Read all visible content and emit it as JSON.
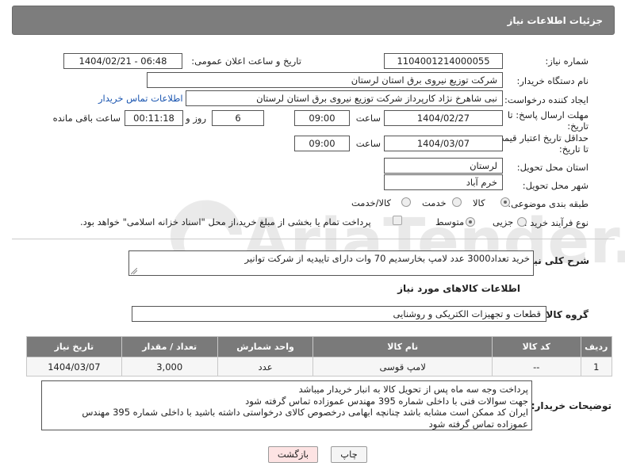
{
  "header": {
    "title": "جزئیات اطلاعات نیاز"
  },
  "form": {
    "need_number": {
      "label": "شماره نیاز:",
      "value": "1104001214000055"
    },
    "announce_datetime": {
      "label": "تاریخ و ساعت اعلان عمومی:",
      "value": "1404/02/21 - 06:48"
    },
    "buyer_org": {
      "label": "نام دستگاه خریدار:",
      "value": "شرکت توزیع نیروی برق استان لرستان"
    },
    "requester": {
      "label": "ایجاد کننده درخواست:",
      "value": "نبی شاهرخ نژاد کارپرداز شرکت توزیع نیروی برق استان لرستان",
      "contact_link": "اطلاعات تماس خریدار"
    },
    "reply_deadline": {
      "label_line1": "مهلت ارسال پاسخ: تا",
      "label_line2": "تاریخ:",
      "date": "1404/02/27",
      "time_label": "ساعت",
      "time": "09:00",
      "days": "6",
      "days_label": "روز و",
      "remaining": "00:11:18",
      "remaining_label": "ساعت باقی مانده"
    },
    "price_validity": {
      "label_line1": "حداقل تاریخ اعتبار قیمت:",
      "label_line2": "تا تاریخ:",
      "date": "1404/03/07",
      "time_label": "ساعت",
      "time": "09:00"
    },
    "delivery_province": {
      "label": "استان محل تحویل:",
      "value": "لرستان"
    },
    "delivery_city": {
      "label": "شهر محل تحویل:",
      "value": "خرم آباد"
    },
    "category": {
      "label": "طبقه بندی موضوعی:",
      "options": [
        "کالا",
        "خدمت",
        "کالا/خدمت"
      ],
      "selected": "کالا"
    },
    "purchase_type": {
      "label": "نوع فرآیند خرید :",
      "options": [
        "جزیی",
        "متوسط"
      ],
      "selected": "متوسط",
      "note": "پرداخت تمام یا بخشی از مبلغ خرید،از محل \"اسناد خزانه اسلامی\" خواهد بود."
    }
  },
  "description": {
    "label": "شرح کلی نیاز:",
    "value": "خرید تعداد3000 عدد لامپ بخارسدیم 70 وات دارای تاییدیه از شرکت توانیر"
  },
  "goods_section": {
    "title": "اطلاعات کالاهای مورد نیاز",
    "group_label": "گروه کالا:",
    "group_value": "قطعات و تجهیزات الکتریکی و روشنایی",
    "columns": [
      "ردیف",
      "کد کالا",
      "نام کالا",
      "واحد شمارش",
      "تعداد / مقدار",
      "تاریخ نیاز"
    ],
    "rows": [
      {
        "row": "1",
        "code": "--",
        "name": "لامپ قوسی",
        "unit": "عدد",
        "qty": "3,000",
        "date": "1404/03/07"
      }
    ]
  },
  "buyer_notes": {
    "label": "توضیحات خریدار:",
    "lines": [
      "پرداخت وجه سه ماه پس از تحویل کالا  به انبار خریدار میباشد",
      "جهت سوالات فنی با داخلی شماره 395 مهندس عموزاده تماس گرفته شود",
      "ایران کد ممکن است مشابه باشد چنانچه ابهامی درخصوص کالای درخواستی داشته باشید با داخلی شماره 395 مهندس",
      "عموزاده تماس گرفته شود"
    ]
  },
  "buttons": {
    "print": "چاپ",
    "back": "بازگشت"
  },
  "watermark": {
    "text": "AriaTender.neT"
  },
  "colors": {
    "header_bg": "#7d7d7d",
    "table_header_bg": "#7a7a7a",
    "link": "#1a55b0",
    "back_button_bg": "#fde3e3"
  }
}
